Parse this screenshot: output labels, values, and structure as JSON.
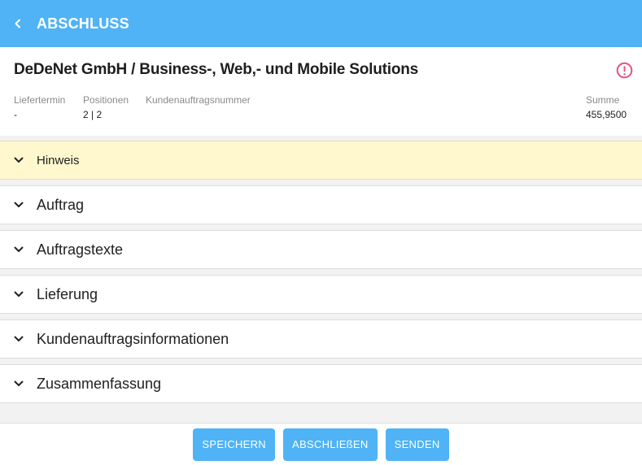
{
  "appbar": {
    "title": "ABSCHLUSS",
    "back_icon": "chevron-left-icon"
  },
  "header": {
    "company": "DeDeNet GmbH / Business-, Web,- und Mobile Solutions",
    "alert_icon": "alert-circle-icon",
    "alert_color": "#e8507f",
    "fields": [
      {
        "label": "Liefertermin",
        "value": "-"
      },
      {
        "label": "Positionen",
        "value": "2 | 2"
      },
      {
        "label": "Kundenauftragsnummer",
        "value": ""
      },
      {
        "label": "Summe",
        "value": "455,9500"
      }
    ]
  },
  "panels": [
    {
      "label": "Hinweis"
    },
    {
      "label": "Auftrag"
    },
    {
      "label": "Auftragstexte"
    },
    {
      "label": "Lieferung"
    },
    {
      "label": "Kundenauftragsinformationen"
    },
    {
      "label": "Zusammenfassung"
    }
  ],
  "footer": {
    "save": "SPEICHERN",
    "finish": "ABSCHLIEßEN",
    "send": "SENDEN"
  },
  "colors": {
    "accent": "#4fb3f6",
    "hint_bg": "#fff8cf"
  }
}
